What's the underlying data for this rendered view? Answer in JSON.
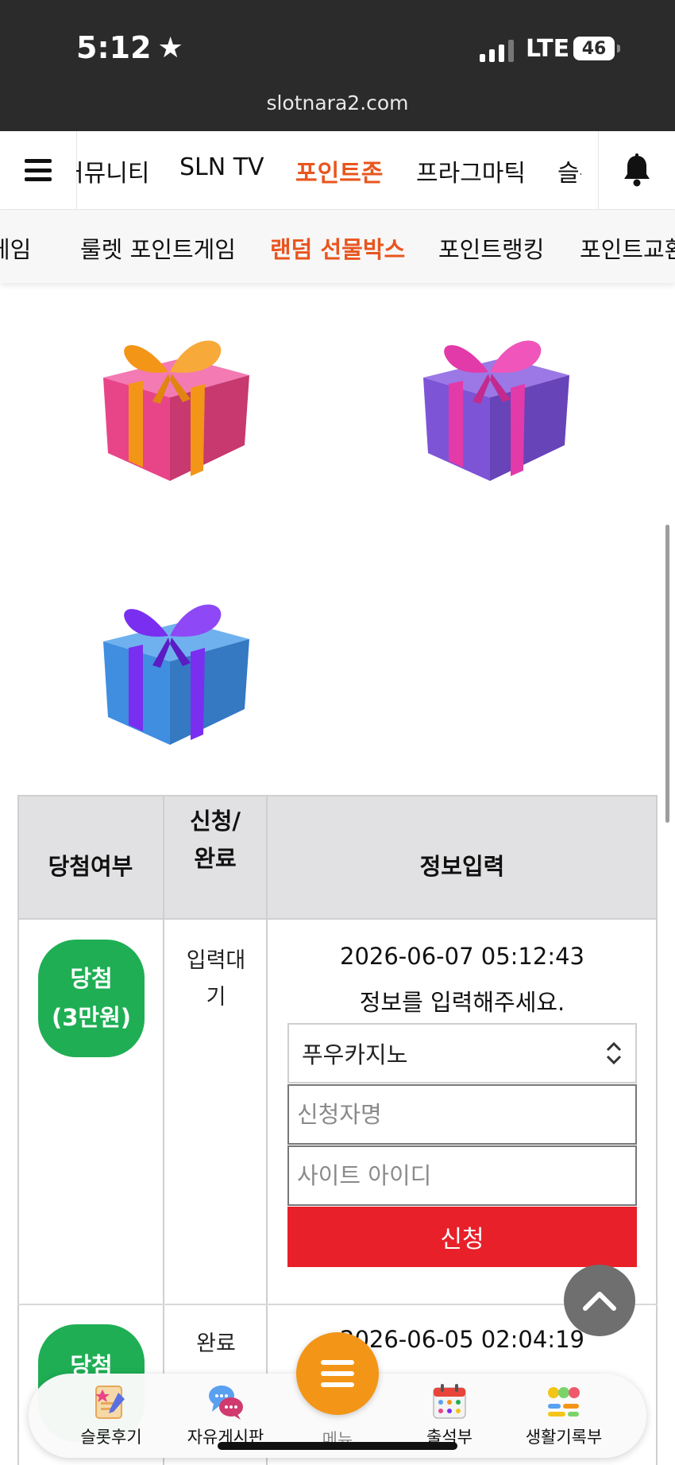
{
  "status_bar": {
    "time": "5:12",
    "network": "LTE",
    "battery": "46"
  },
  "browser": {
    "url": "slotnara2.com"
  },
  "nav_primary": {
    "tabs": [
      "커뮤니티",
      "SLN TV",
      "포인트존",
      "프라그마틱",
      "슬롯"
    ],
    "active": "포인트존"
  },
  "nav_secondary": {
    "tabs": [
      "게임",
      "룰렛 포인트게임",
      "랜덤 선물박스",
      "포인트랭킹",
      "포인트교환"
    ],
    "active": "랜덤 선물박스"
  },
  "gifts": [
    {
      "color": "pink",
      "ribbon": "#f39517"
    },
    {
      "color": "purple",
      "ribbon": "#e23aa8"
    },
    {
      "color": "blue",
      "ribbon": "#7a2ef0"
    }
  ],
  "table": {
    "headers": {
      "result": "당첨여부",
      "status_line1": "신청/",
      "status_line2": "완료",
      "info": "정보입력"
    },
    "rows": [
      {
        "badge_line1": "당첨",
        "badge_line2": "(3만원)",
        "status_line1": "입력대",
        "status_line2": "기",
        "datetime": "2026-06-07 05:12:43",
        "prompt": "정보를 입력해주세요.",
        "select_value": "푸우카지노",
        "name_placeholder": "신청자명",
        "id_placeholder": "사이트 아이디",
        "submit_label": "신청"
      },
      {
        "badge_line1": "당첨",
        "status_line1": "완료",
        "datetime": "2026-06-05 02:04:19"
      }
    ]
  },
  "bottom_nav": {
    "items": [
      "슬롯후기",
      "자유게시판",
      "메뉴",
      "출석부",
      "생활기록부"
    ]
  },
  "colors": {
    "accent": "#e8551e",
    "win_badge": "#1fae54",
    "submit": "#e8202a",
    "fab": "#f39517"
  }
}
